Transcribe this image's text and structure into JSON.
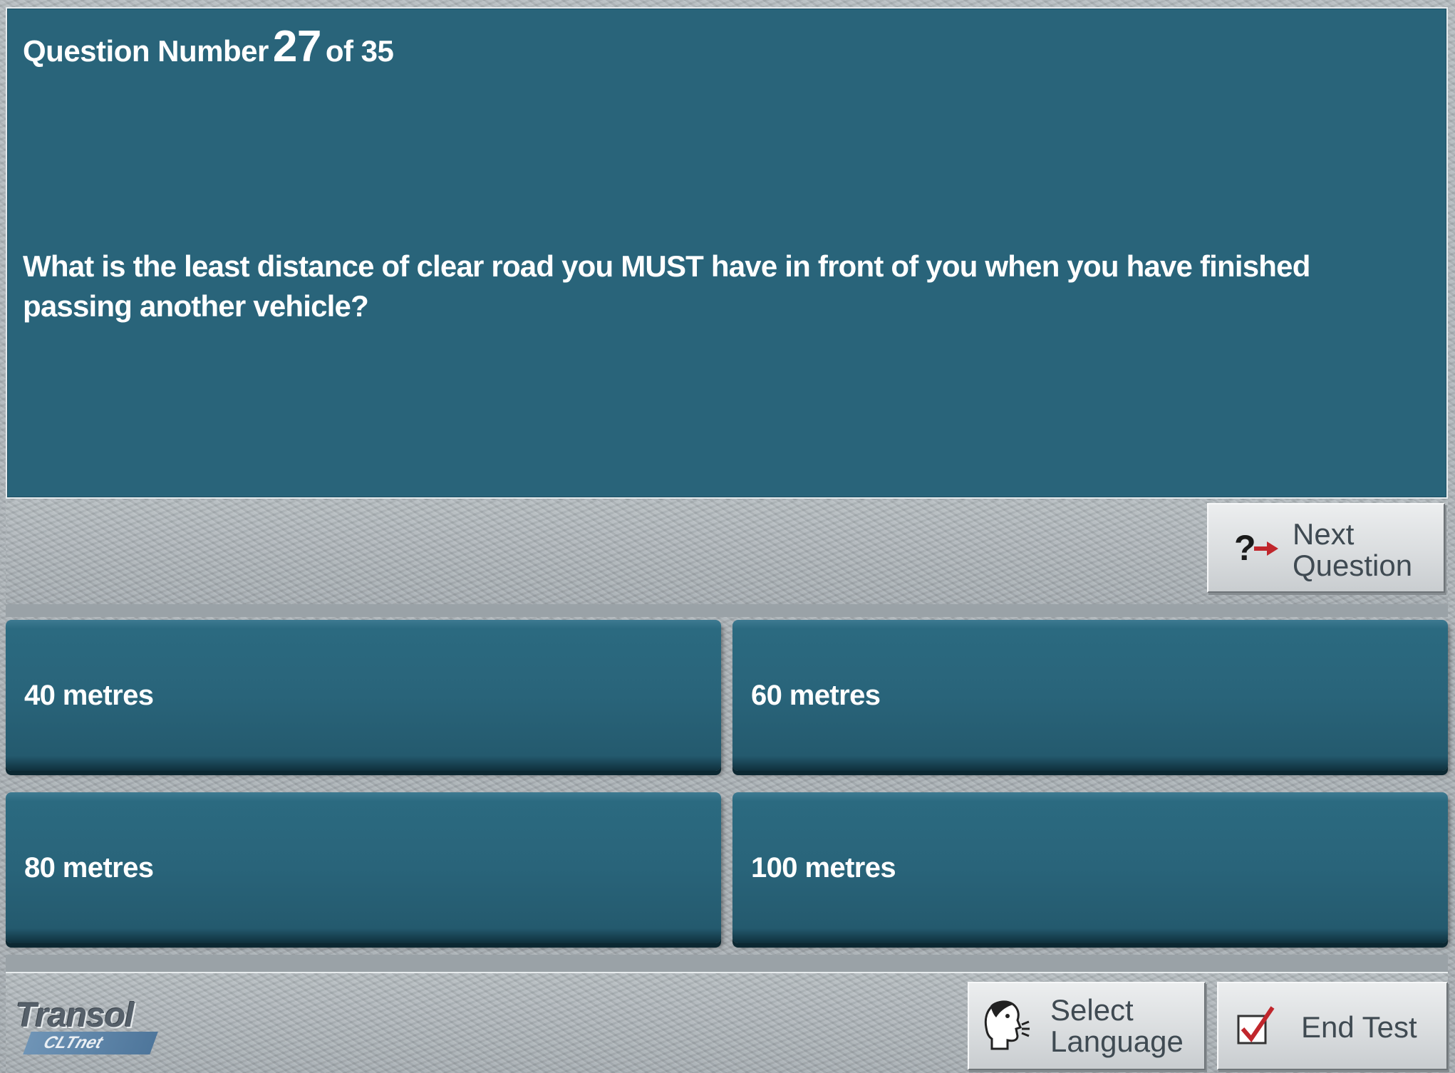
{
  "header": {
    "question_prefix": "Question Number",
    "question_number": "27",
    "question_suffix": "of 35"
  },
  "question": {
    "text": "What is the least distance of clear road you MUST have in front of you when you have finished passing another vehicle?"
  },
  "answers": [
    {
      "label": "40 metres"
    },
    {
      "label": "60 metres"
    },
    {
      "label": "80 metres"
    },
    {
      "label": "100 metres"
    }
  ],
  "buttons": {
    "next_line1": "Next",
    "next_line2": "Question",
    "language_line1": "Select",
    "language_line2": "Language",
    "end_test": "End Test"
  },
  "logo": {
    "name": "Transol",
    "sub": "CLTnet"
  },
  "colors": {
    "panel": "#29647a",
    "text": "#ffffff",
    "arrow": "#c0262c"
  },
  "icons": {
    "next": "question-arrow-icon",
    "language": "speaking-head-icon",
    "end": "checkbox-check-icon"
  }
}
